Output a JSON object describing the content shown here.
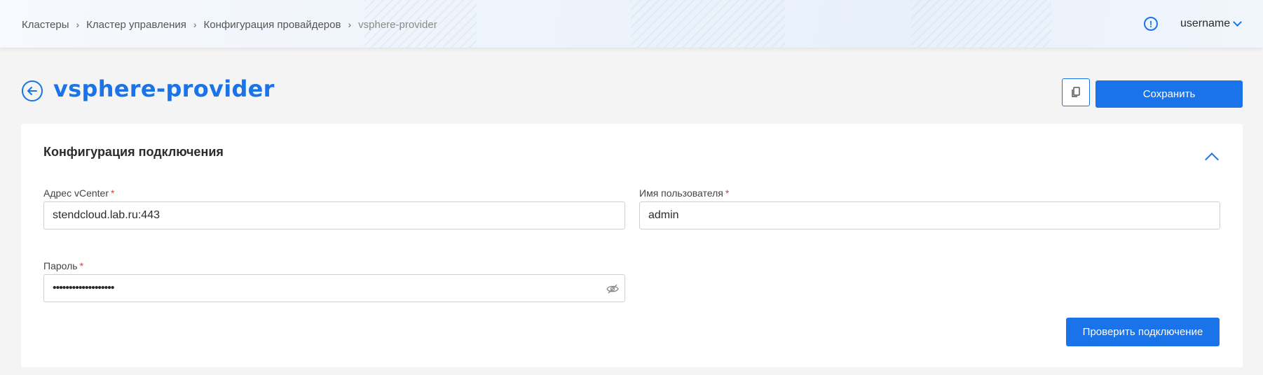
{
  "breadcrumb": {
    "items": [
      "Кластеры",
      "Кластер управления",
      "Конфигурация провайдеров",
      "vsphere-provider"
    ]
  },
  "header": {
    "username": "username",
    "info_icon": "info-circle-icon"
  },
  "page": {
    "title": "vsphere-provider",
    "save_label": "Сохранить"
  },
  "section": {
    "title": "Конфигурация подключения",
    "vcenter": {
      "label": "Адрес vCenter",
      "required": "*",
      "value": "stendcloud.lab.ru:443"
    },
    "username": {
      "label": "Имя пользователя",
      "required": "*",
      "value": "admin"
    },
    "password": {
      "label": "Пароль",
      "required": "*",
      "value": "•••••••••••••••••••"
    },
    "check_label": "Проверить подключение"
  },
  "colors": {
    "accent": "#1a73e8",
    "required": "#e53935",
    "background": "#f4f4f4"
  }
}
